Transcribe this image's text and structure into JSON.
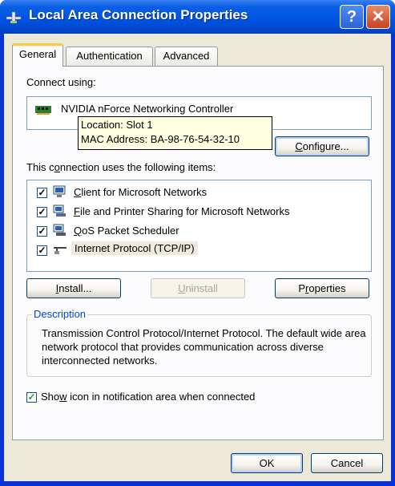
{
  "window": {
    "title": "Local Area Connection Properties",
    "help_glyph": "?",
    "close_glyph": "✕",
    "colors": {
      "titlebar": "#0054e3",
      "frame": "#0831d9",
      "face": "#ece9d8"
    }
  },
  "tabs": [
    {
      "label": "General",
      "active": true
    },
    {
      "label": "Authentication",
      "active": false
    },
    {
      "label": "Advanced",
      "active": false
    }
  ],
  "connect_using": {
    "label": "Connect using:",
    "adapter_name": "NVIDIA nForce Networking Controller",
    "adapter_icon": "network-card-icon"
  },
  "tooltip": {
    "line1": "Location: Slot 1",
    "line2": "MAC Address: BA-98-76-54-32-10"
  },
  "configure_button": {
    "pre": "",
    "accel": "C",
    "post": "onfigure..."
  },
  "items_label": {
    "pre": "This c",
    "accel": "o",
    "post": "nnection uses the following items:"
  },
  "items": [
    {
      "label_pre": "",
      "label_accel": "C",
      "label_post": "lient for Microsoft Networks",
      "checked": true,
      "icon": "network-client-icon"
    },
    {
      "label_pre": "",
      "label_accel": "F",
      "label_post": "ile and Printer Sharing for Microsoft Networks",
      "checked": true,
      "icon": "file-printer-sharing-icon"
    },
    {
      "label_pre": "",
      "label_accel": "Q",
      "label_post": "oS Packet Scheduler",
      "checked": true,
      "icon": "qos-scheduler-icon"
    },
    {
      "label_pre": "",
      "label_accel": "",
      "label_post": "Internet Protocol (TCP/IP)",
      "checked": true,
      "icon": "network-protocol-icon"
    }
  ],
  "buttons": {
    "install": {
      "pre": "",
      "accel": "I",
      "post": "nstall..."
    },
    "uninstall": {
      "pre": "",
      "accel": "U",
      "post": "ninstall"
    },
    "properties": {
      "pre": "P",
      "accel": "r",
      "post": "operties"
    }
  },
  "description": {
    "legend": "Description",
    "text": "Transmission Control Protocol/Internet Protocol. The default wide area network protocol that provides communication across diverse interconnected networks."
  },
  "show_icon": {
    "pre": "Sho",
    "accel": "w",
    "post": " icon in notification area when connected",
    "checked": true
  },
  "footer": {
    "ok": "OK",
    "cancel": "Cancel"
  }
}
